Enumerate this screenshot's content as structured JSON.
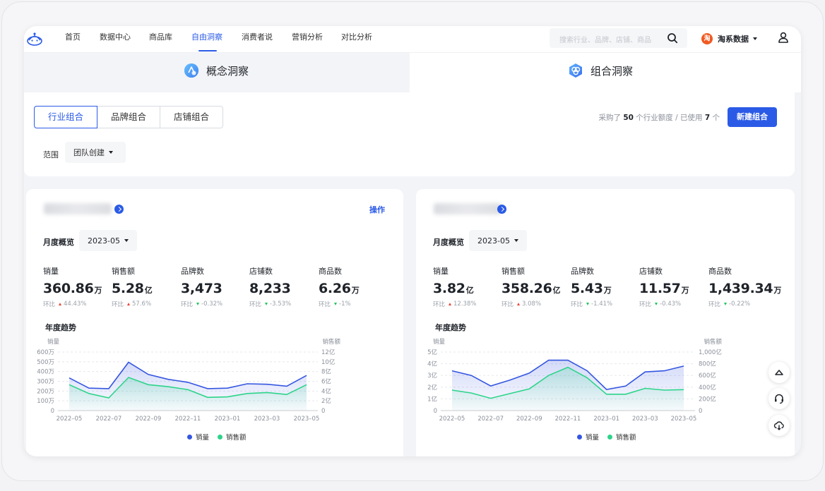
{
  "nav": {
    "items": [
      "首页",
      "数据中心",
      "商品库",
      "自由洞察",
      "消费者说",
      "营销分析",
      "对比分析"
    ],
    "active_index": 3,
    "search_placeholder": "搜索行业、品牌、店铺、商品",
    "brand_logo_text": "淘",
    "brand_name": "淘系数据"
  },
  "modes": {
    "concept": "概念洞察",
    "combo": "组合洞察"
  },
  "combo_panel": {
    "segments": [
      "行业组合",
      "品牌组合",
      "店铺组合"
    ],
    "active_segment": 0,
    "quota_prefix": "采购了",
    "quota_total": "50",
    "quota_mid": "个行业额度 / 已使用",
    "quota_used": "7",
    "quota_suffix": "个",
    "new_button": "新建组合",
    "scope_label": "范围",
    "scope_value": "团队创建"
  },
  "cards": [
    {
      "operation": "操作",
      "month_label": "月度概览",
      "month_value": "2023-05",
      "metrics": [
        {
          "label": "销量",
          "value": "360.86",
          "unit": "万",
          "cmp_label": "环比",
          "cmp_value": "44.43%",
          "dir": "up"
        },
        {
          "label": "销售额",
          "value": "5.28",
          "unit": "亿",
          "cmp_label": "环比",
          "cmp_value": "57.6%",
          "dir": "up"
        },
        {
          "label": "品牌数",
          "value": "3,473",
          "unit": "",
          "cmp_label": "环比",
          "cmp_value": "-0.32%",
          "dir": "down"
        },
        {
          "label": "店铺数",
          "value": "8,233",
          "unit": "",
          "cmp_label": "环比",
          "cmp_value": "-3.53%",
          "dir": "down"
        },
        {
          "label": "商品数",
          "value": "6.26",
          "unit": "万",
          "cmp_label": "环比",
          "cmp_value": "-1%",
          "dir": "down"
        }
      ],
      "trend_title": "年度趋势",
      "legend": [
        "销量",
        "销售额"
      ]
    },
    {
      "operation": "",
      "month_label": "月度概览",
      "month_value": "2023-05",
      "metrics": [
        {
          "label": "销量",
          "value": "3.82",
          "unit": "亿",
          "cmp_label": "环比",
          "cmp_value": "12.38%",
          "dir": "up"
        },
        {
          "label": "销售额",
          "value": "358.26",
          "unit": "亿",
          "cmp_label": "环比",
          "cmp_value": "3.08%",
          "dir": "up"
        },
        {
          "label": "品牌数",
          "value": "5.43",
          "unit": "万",
          "cmp_label": "环比",
          "cmp_value": "-1.41%",
          "dir": "down"
        },
        {
          "label": "店铺数",
          "value": "11.57",
          "unit": "万",
          "cmp_label": "环比",
          "cmp_value": "-0.43%",
          "dir": "down"
        },
        {
          "label": "商品数",
          "value": "1,439.34",
          "unit": "万",
          "cmp_label": "环比",
          "cmp_value": "-0.22%",
          "dir": "down"
        }
      ],
      "trend_title": "年度趋势",
      "legend": [
        "销量",
        "销售额"
      ]
    }
  ],
  "colors": {
    "accent": "#2b5be6",
    "series_sales_volume": "#3556e0",
    "series_sales_amount": "#2dd48a"
  },
  "chart_data": [
    {
      "type": "line",
      "title": "年度趋势",
      "ylabel": "销量",
      "y2label": "销售额",
      "x": [
        "2022-05",
        "2022-06",
        "2022-07",
        "2022-08",
        "2022-09",
        "2022-10",
        "2022-11",
        "2022-12",
        "2023-01",
        "2023-02",
        "2023-03",
        "2023-04",
        "2023-05"
      ],
      "x_tick_labels": [
        "2022–05",
        "2022–07",
        "2022–09",
        "2022–11",
        "2023–01",
        "2023–03",
        "2023–05"
      ],
      "y_ticks": [
        "0",
        "100万",
        "200万",
        "300万",
        "400万",
        "500万",
        "600万"
      ],
      "y2_ticks": [
        "0",
        "2亿",
        "4亿",
        "6亿",
        "8亿",
        "10亿",
        "12亿"
      ],
      "ylim": [
        0,
        600
      ],
      "y2lim": [
        0,
        12
      ],
      "series": [
        {
          "name": "销量",
          "axis": "left",
          "values": [
            335,
            230,
            225,
            495,
            370,
            320,
            290,
            225,
            230,
            275,
            270,
            250,
            360
          ]
        },
        {
          "name": "销售额",
          "axis": "right",
          "values": [
            5.3,
            3.5,
            2.6,
            6.8,
            5.3,
            4.9,
            4.3,
            2.7,
            2.8,
            3.5,
            3.7,
            3.3,
            5.3
          ]
        }
      ]
    },
    {
      "type": "line",
      "title": "年度趋势",
      "ylabel": "销量",
      "y2label": "销售额",
      "x": [
        "2022-05",
        "2022-06",
        "2022-07",
        "2022-08",
        "2022-09",
        "2022-10",
        "2022-11",
        "2022-12",
        "2023-01",
        "2023-02",
        "2023-03",
        "2023-04",
        "2023-05"
      ],
      "x_tick_labels": [
        "2022–05",
        "2022–07",
        "2022–09",
        "2022–11",
        "2023–01",
        "2023–03",
        "2023–05"
      ],
      "y_ticks": [
        "0",
        "1亿",
        "2亿",
        "3亿",
        "4亿",
        "5亿"
      ],
      "y2_ticks": [
        "0",
        "200亿",
        "400亿",
        "600亿",
        "800亿",
        "1,000亿"
      ],
      "ylim": [
        0,
        5
      ],
      "y2lim": [
        0,
        1000
      ],
      "series": [
        {
          "name": "销量",
          "axis": "left",
          "values": [
            3.4,
            3.0,
            2.1,
            2.6,
            3.2,
            4.3,
            4.3,
            3.4,
            1.8,
            2.1,
            3.3,
            3.4,
            3.8
          ]
        },
        {
          "name": "销售额",
          "axis": "right",
          "values": [
            350,
            300,
            210,
            290,
            370,
            600,
            740,
            560,
            280,
            280,
            380,
            350,
            358
          ]
        }
      ]
    }
  ]
}
